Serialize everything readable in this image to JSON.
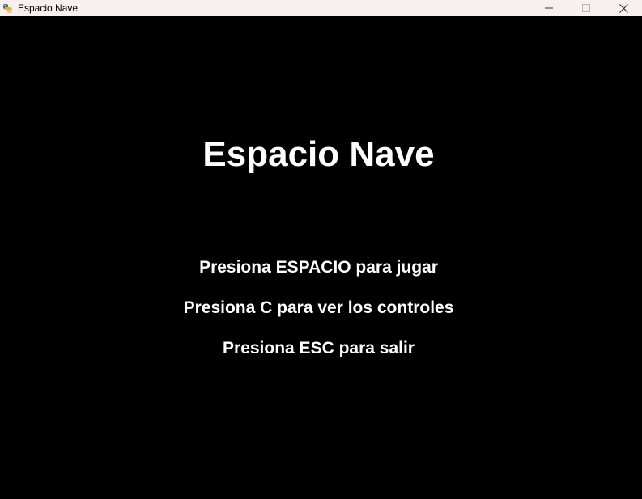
{
  "window": {
    "title": "Espacio Nave",
    "icon": "python-snake-icon",
    "controls": [
      "minimize-icon",
      "maximize-icon",
      "close-icon"
    ],
    "titlebar_color": "#f7f0ee"
  },
  "game": {
    "background_color": "#000000",
    "text_color": "#ffffff",
    "title": "Espacio Nave",
    "menu": [
      "Presiona ESPACIO para jugar",
      "Presiona C para ver los controles",
      "Presiona ESC para salir"
    ]
  }
}
